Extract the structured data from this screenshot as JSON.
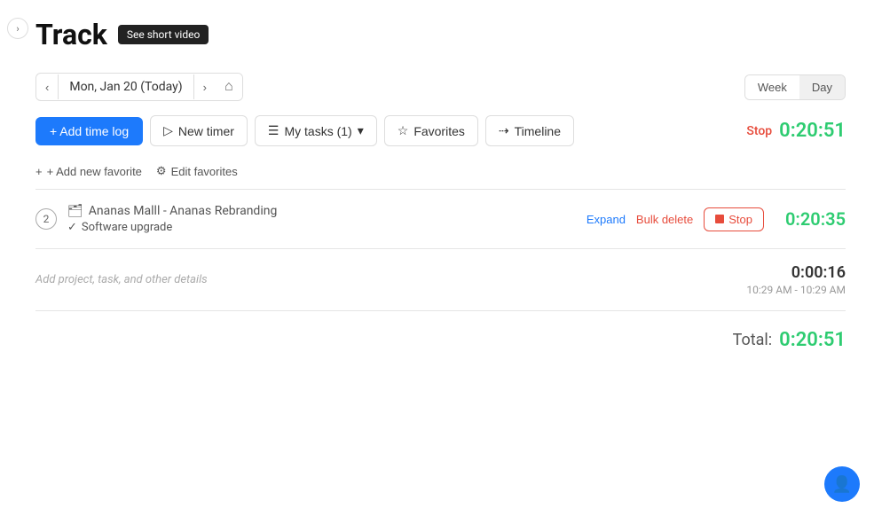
{
  "sidebar_toggle": {
    "icon": "›",
    "label": "toggle sidebar"
  },
  "page": {
    "title": "Track",
    "video_badge": "See short video"
  },
  "date_nav": {
    "prev_label": "‹",
    "next_label": "›",
    "date_label": "Mon, Jan 20 (Today)",
    "home_icon": "⌂"
  },
  "view_toggle": {
    "week_label": "Week",
    "day_label": "Day",
    "active": "Day"
  },
  "actions": {
    "add_time_label": "+ Add time log",
    "new_timer_label": "New timer",
    "my_tasks_label": "My tasks (1)",
    "favorites_label": "Favorites",
    "timeline_label": "Timeline"
  },
  "running_timer": {
    "stop_label": "Stop",
    "time": "0:20:51"
  },
  "favorites_bar": {
    "add_favorite_label": "+ Add new favorite",
    "edit_favorites_label": "Edit favorites"
  },
  "time_entries": [
    {
      "count": "2",
      "project": "Ananas Malll - Ananas Rebranding",
      "task": "Software upgrade",
      "expand_label": "Expand",
      "bulk_delete_label": "Bulk delete",
      "stop_label": "Stop",
      "duration": "0:20:35"
    }
  ],
  "single_entry": {
    "add_details_placeholder": "Add project, task, and other details",
    "duration": "0:00:16",
    "time_range": "10:29 AM - 10:29 AM"
  },
  "total": {
    "label": "Total:",
    "time": "0:20:51"
  },
  "icons": {
    "briefcase": "🗂",
    "check": "✓",
    "star": "☆",
    "arrow_right": "→",
    "play": "▷",
    "list": "≡",
    "gear": "⚙"
  }
}
